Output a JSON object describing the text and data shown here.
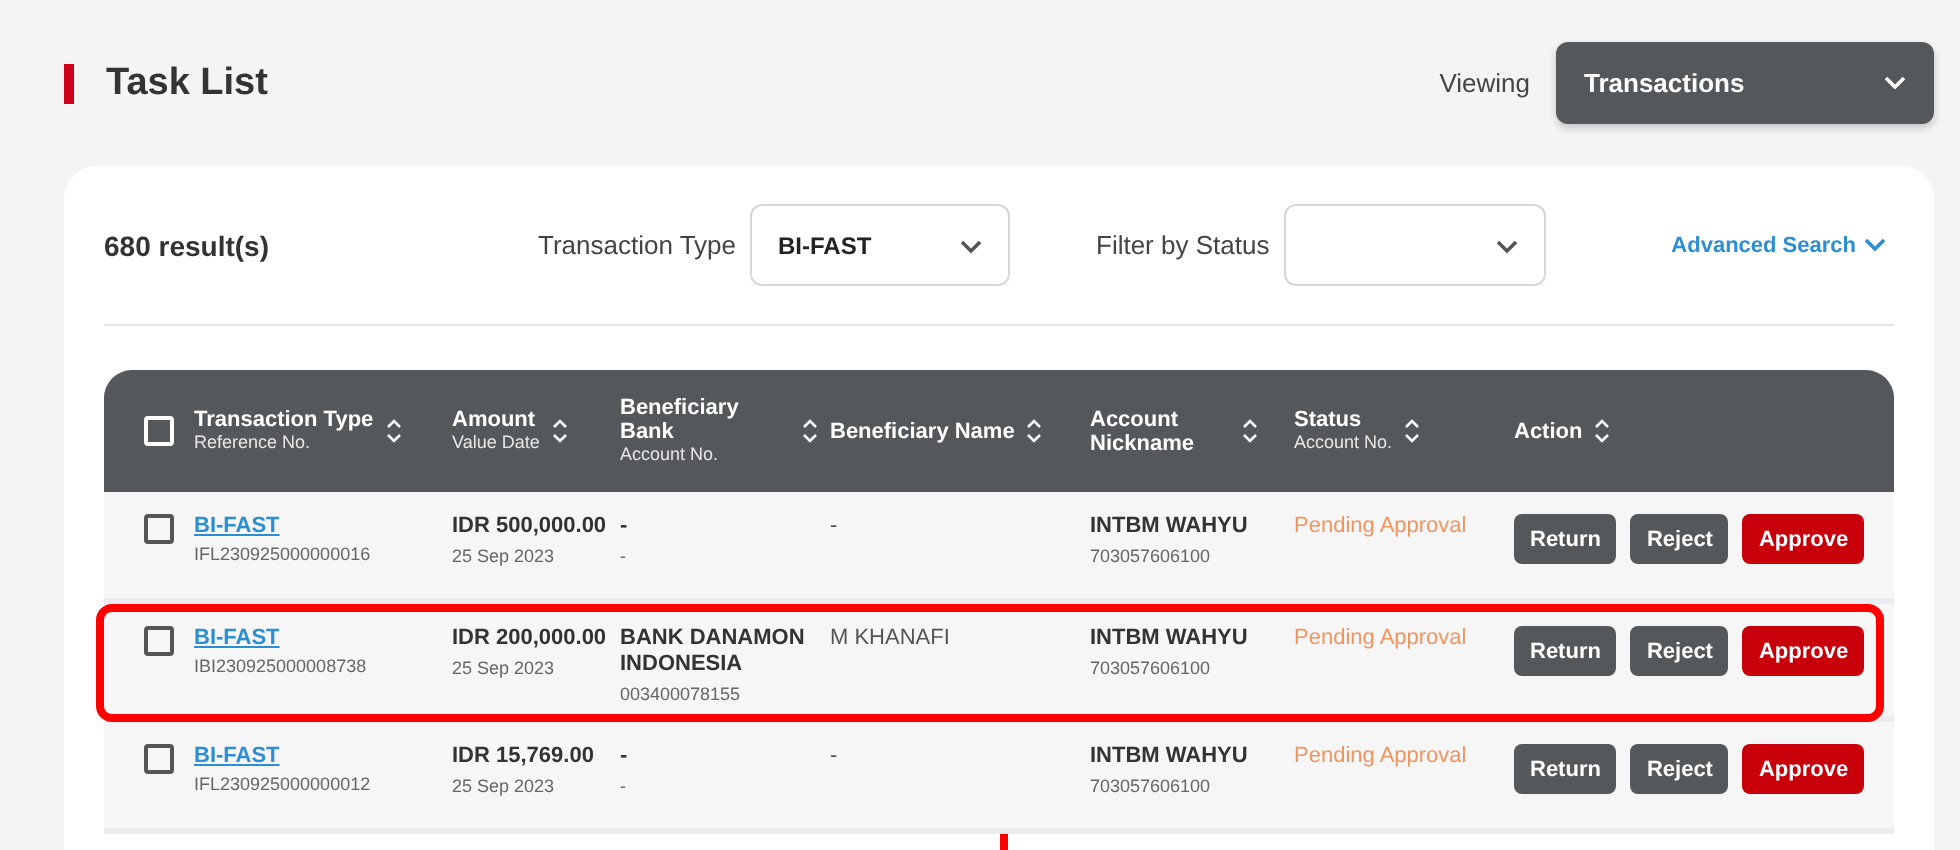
{
  "header": {
    "title": "Task List",
    "viewing_label": "Viewing",
    "viewing_value": "Transactions"
  },
  "filters": {
    "result_count": "680 result(s)",
    "transaction_type_label": "Transaction Type",
    "transaction_type_value": "BI-FAST",
    "status_label": "Filter by Status",
    "advanced_search": "Advanced Search"
  },
  "table": {
    "select_all_checked": false,
    "columns": [
      {
        "title": "Transaction Type",
        "subtitle": "Reference No."
      },
      {
        "title": "Amount",
        "subtitle": "Value Date"
      },
      {
        "title": "Beneficiary Bank",
        "subtitle": "Account No."
      },
      {
        "title": "Beneficiary Name"
      },
      {
        "title": "Account Nickname"
      },
      {
        "title": "Status",
        "subtitle": "Account No."
      },
      {
        "title": "Action"
      }
    ],
    "rows": [
      {
        "checked": false,
        "highlighted": false,
        "type": "BI-FAST",
        "reference": "IFL230925000000016",
        "amount": "IDR 500,000.00",
        "date": "25 Sep 2023",
        "bank": "-",
        "bank_account": "-",
        "name": "-",
        "nickname": "INTBM WAHYU",
        "nickname_account": "703057606100",
        "status": "Pending Approval",
        "actions": [
          {
            "label": "Return",
            "kind": "secondary"
          },
          {
            "label": "Reject",
            "kind": "secondary"
          },
          {
            "label": "Approve",
            "kind": "primary"
          }
        ]
      },
      {
        "checked": false,
        "highlighted": true,
        "type": "BI-FAST",
        "reference": "IBI230925000008738",
        "amount": "IDR 200,000.00",
        "date": "25 Sep 2023",
        "bank": "BANK DANAMON INDONESIA",
        "bank_account": "003400078155",
        "name": "M KHANAFI",
        "nickname": "INTBM WAHYU",
        "nickname_account": "703057606100",
        "status": "Pending Approval",
        "actions": [
          {
            "label": "Return",
            "kind": "secondary"
          },
          {
            "label": "Reject",
            "kind": "secondary"
          },
          {
            "label": "Approve",
            "kind": "primary"
          }
        ]
      },
      {
        "checked": false,
        "highlighted": false,
        "type": "BI-FAST",
        "reference": "IFL230925000000012",
        "amount": "IDR 15,769.00",
        "date": "25 Sep 2023",
        "bank": "-",
        "bank_account": "-",
        "name": "-",
        "nickname": "INTBM WAHYU",
        "nickname_account": "703057606100",
        "status": "Pending Approval",
        "actions": [
          {
            "label": "Return",
            "kind": "secondary"
          },
          {
            "label": "Reject",
            "kind": "secondary"
          },
          {
            "label": "Approve",
            "kind": "primary"
          }
        ]
      }
    ]
  }
}
